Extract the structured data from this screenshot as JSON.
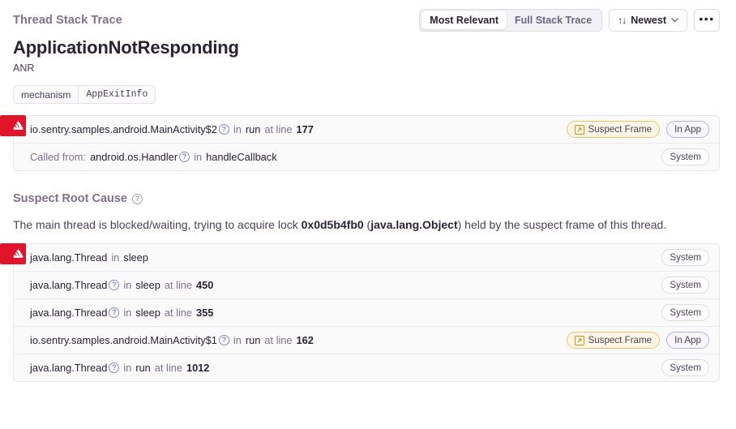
{
  "header": {
    "section_title": "Thread Stack Trace",
    "segmented": [
      {
        "label": "Most Relevant",
        "active": true
      },
      {
        "label": "Full Stack Trace",
        "active": false
      }
    ],
    "sort": {
      "glyph": "↑↓",
      "label": "Newest",
      "chevron": "⌄"
    },
    "more_label": "•••"
  },
  "title": {
    "error_type": "ApplicationNotResponding",
    "error_subtitle": "ANR"
  },
  "tag": {
    "key": "mechanism",
    "value": "AppExitInfo"
  },
  "primary_frames": [
    {
      "lead": "",
      "package": "io.sentry.samples.android.MainActivity$2",
      "has_help": true,
      "in": "in",
      "function": "run",
      "at_line": "at line",
      "line": "177",
      "badges": [
        {
          "text": "Suspect Frame",
          "style": "suspect",
          "icon": "external-link-box-icon"
        },
        {
          "text": "In App",
          "style": "inapp",
          "icon": null
        }
      ]
    },
    {
      "lead": "Called from:",
      "package": "android.os.Handler",
      "has_help": true,
      "in": "in",
      "function": "handleCallback",
      "at_line": "",
      "line": "",
      "badges": [
        {
          "text": "System",
          "style": "system",
          "icon": null
        }
      ]
    }
  ],
  "suspect_root_cause": {
    "heading": "Suspect Root Cause",
    "help_glyph": "?",
    "text_before": "The main thread is blocked/waiting, trying to acquire lock ",
    "lock_address": "0x0d5b4fb0",
    "paren_open": " (",
    "lock_class": "java.lang.Object",
    "paren_close": ")",
    "text_after": " held by the suspect frame of this thread."
  },
  "root_cause_frames": [
    {
      "lead": "",
      "package": "java.lang.Thread",
      "has_help": false,
      "in": "in",
      "function": "sleep",
      "at_line": "",
      "line": "",
      "badges": [
        {
          "text": "System",
          "style": "system",
          "icon": null
        }
      ]
    },
    {
      "lead": "",
      "package": "java.lang.Thread",
      "has_help": true,
      "in": "in",
      "function": "sleep",
      "at_line": "at line",
      "line": "450",
      "badges": [
        {
          "text": "System",
          "style": "system",
          "icon": null
        }
      ]
    },
    {
      "lead": "",
      "package": "java.lang.Thread",
      "has_help": true,
      "in": "in",
      "function": "sleep",
      "at_line": "at line",
      "line": "355",
      "badges": [
        {
          "text": "System",
          "style": "system",
          "icon": null
        }
      ]
    },
    {
      "lead": "",
      "package": "io.sentry.samples.android.MainActivity$1",
      "has_help": true,
      "in": "in",
      "function": "run",
      "at_line": "at line",
      "line": "162",
      "badges": [
        {
          "text": "Suspect Frame",
          "style": "suspect",
          "icon": "external-link-box-icon"
        },
        {
          "text": "In App",
          "style": "inapp",
          "icon": null
        }
      ]
    },
    {
      "lead": "",
      "package": "java.lang.Thread",
      "has_help": true,
      "in": "in",
      "function": "run",
      "at_line": "at line",
      "line": "1012",
      "badges": [
        {
          "text": "System",
          "style": "system",
          "icon": null
        }
      ]
    }
  ],
  "colors": {
    "accent_red": "#e1142b",
    "suspect_orange": "#e08e0b",
    "in_app_purple": "#b7b0e8",
    "text_primary": "#2b2233",
    "text_muted": "#80708f"
  }
}
